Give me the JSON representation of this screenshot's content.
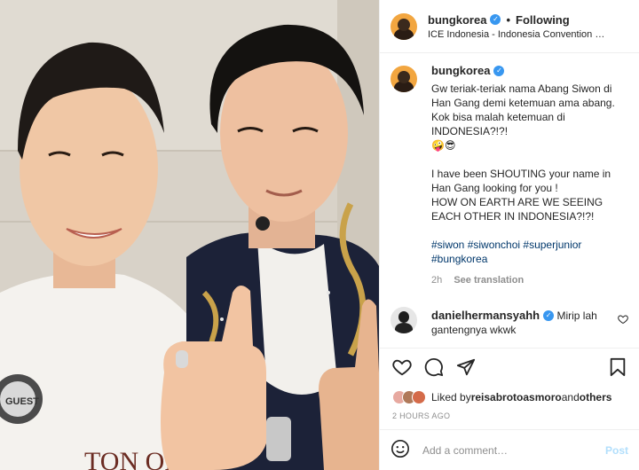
{
  "post": {
    "username": "bungkorea",
    "separator": "•",
    "follow_state": "Following",
    "location": "ICE Indonesia - Indonesia Convention …"
  },
  "caption": {
    "username": "bungkorea",
    "lines": [
      "Gw teriak-teriak nama Abang Siwon di",
      "Han Gang demi ketemuan ama abang.",
      "Kok bisa malah ketemuan di",
      "INDONESIA?!?!",
      "🤪😎",
      "",
      "I have been SHOUTING your name in",
      "Han Gang looking for you !",
      "HOW ON EARTH ARE WE SEEING",
      "EACH OTHER IN INDONESIA?!?!"
    ],
    "hashtags_line1": "#siwon #siwonchoi #superjunior",
    "hashtags_line2": "#bungkorea",
    "age": "2h",
    "see_translation": "See translation"
  },
  "comment": {
    "username": "danielhermansyahh",
    "text_line1": "Mirip lah",
    "text_line2": "gantengnya wkwk"
  },
  "likes": {
    "prefix": "Liked by ",
    "user": "reisabrotoasmoro",
    "and": " and ",
    "others": "others"
  },
  "timestamp": "2 HOURS AGO",
  "add_comment": {
    "placeholder": "Add a comment…",
    "post_label": "Post"
  },
  "photo": {
    "badge_text": "GUEST",
    "shirt_text": "TON OPP"
  },
  "colors": {
    "verified": "#3897f0",
    "hashtag": "#00376b",
    "post_disabled": "#b2dffc"
  }
}
